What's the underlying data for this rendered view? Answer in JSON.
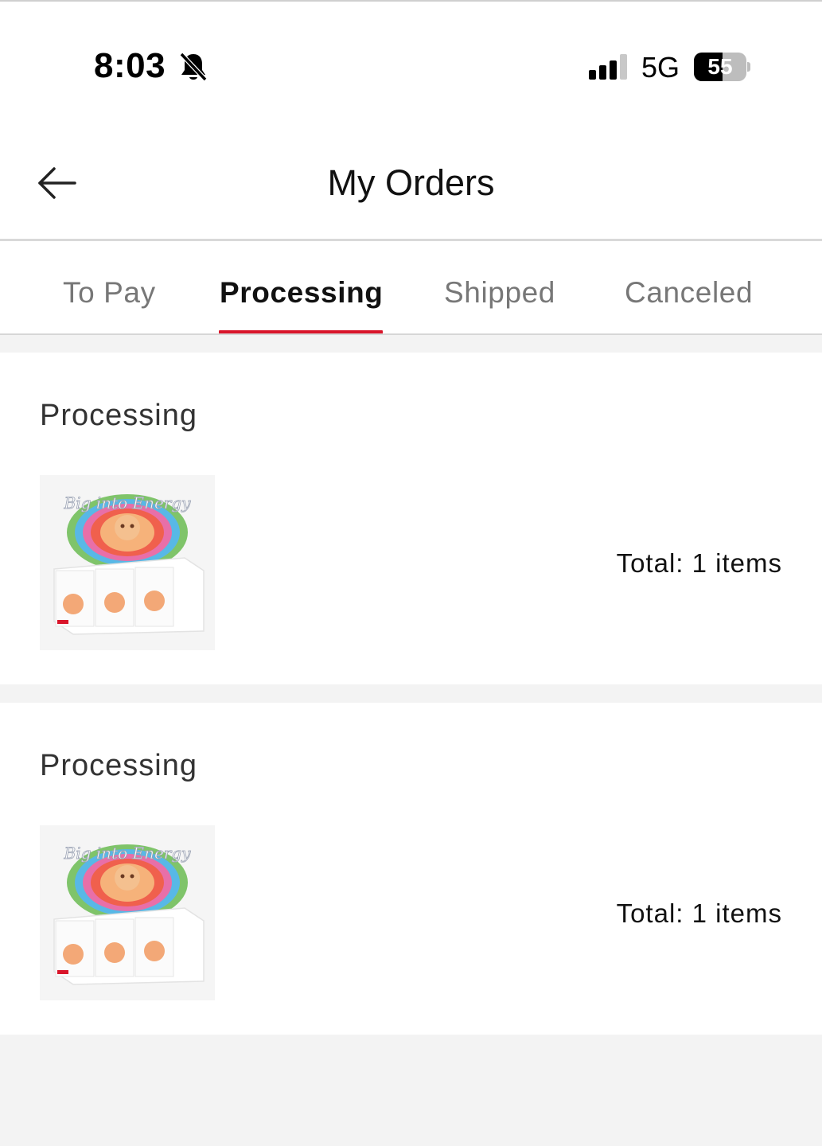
{
  "status_bar": {
    "time": "8:03",
    "network": "5G",
    "battery": "55",
    "battery_level_percent": 55,
    "icons": [
      "bell-slash-icon",
      "signal-icon",
      "battery-icon"
    ]
  },
  "header": {
    "title": "My Orders",
    "back_icon": "arrow-left-icon"
  },
  "tabs": [
    {
      "label": "To Pay",
      "active": false
    },
    {
      "label": "Processing",
      "active": true
    },
    {
      "label": "Shipped",
      "active": false
    },
    {
      "label": "Canceled",
      "active": false
    }
  ],
  "orders": [
    {
      "status": "Processing",
      "total": "Total: 1 items",
      "box_text": "Big into Energy"
    },
    {
      "status": "Processing",
      "total": "Total: 1 items",
      "box_text": "Big into Energy"
    }
  ],
  "colors": {
    "accent": "#d9152a",
    "background": "#f3f3f3",
    "card": "#ffffff",
    "inactive_tab": "#777777"
  }
}
